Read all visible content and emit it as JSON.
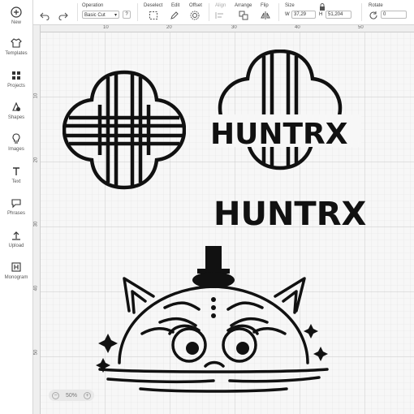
{
  "sidebar": {
    "items": [
      {
        "label": "New",
        "icon": "plus-circle-icon"
      },
      {
        "label": "Templates",
        "icon": "shirt-icon"
      },
      {
        "label": "Projects",
        "icon": "projects-icon"
      },
      {
        "label": "Shapes",
        "icon": "shapes-icon"
      },
      {
        "label": "Images",
        "icon": "lightbulb-icon"
      },
      {
        "label": "Text",
        "icon": "text-icon"
      },
      {
        "label": "Phrases",
        "icon": "speech-bubble-icon"
      },
      {
        "label": "Upload",
        "icon": "upload-icon"
      },
      {
        "label": "Monogram",
        "icon": "monogram-icon"
      }
    ]
  },
  "toolbar": {
    "operation_label": "Operation",
    "operation_value": "Basic Cut",
    "help": "?",
    "deselect": "Deselect",
    "edit": "Edit",
    "offset": "Offset",
    "align": "Align",
    "arrange": "Arrange",
    "flip": "Flip",
    "size": "Size",
    "w_label": "W",
    "w_value": "37,29",
    "h_label": "H",
    "h_value": "51,204",
    "rotate": "Rotate",
    "rotate_value": "0"
  },
  "ruler": {
    "top": [
      "10",
      "20",
      "30",
      "40",
      "50"
    ],
    "left": [
      "10",
      "20",
      "30",
      "40",
      "50"
    ]
  },
  "canvas": {
    "logo_text": "HUNTRX"
  },
  "zoom": {
    "value": "50%",
    "minus": "−",
    "plus": "+"
  }
}
